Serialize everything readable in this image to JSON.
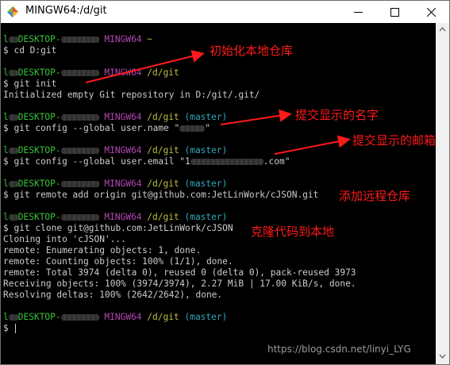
{
  "window": {
    "title": "MINGW64:/d/git"
  },
  "terminal": {
    "prompts": [
      {
        "user_host_fragment": "DESKTOP-",
        "shell": "MINGW64",
        "path": "~",
        "branch": ""
      },
      {
        "user_host_fragment": "DESKTOP-",
        "shell": "MINGW64",
        "path": "/d/git",
        "branch": ""
      },
      {
        "user_host_fragment": "DESKTOP-",
        "shell": "MINGW64",
        "path": "/d/git",
        "branch": "(master)"
      },
      {
        "user_host_fragment": "DESKTOP-",
        "shell": "MINGW64",
        "path": "/d/git",
        "branch": "(master)"
      },
      {
        "user_host_fragment": "DESKTOP-",
        "shell": "MINGW64",
        "path": "/d/git",
        "branch": "(master)"
      },
      {
        "user_host_fragment": "DESKTOP-",
        "shell": "MINGW64",
        "path": "/d/git",
        "branch": "(master)"
      },
      {
        "user_host_fragment": "DESKTOP-",
        "shell": "MINGW64",
        "path": "/d/git",
        "branch": "(master)"
      }
    ],
    "commands": {
      "cd": "$ cd D:git",
      "init": "$ git init",
      "config_name_prefix": "$ git config --global user.name \"",
      "config_name_suffix": "\"",
      "config_email_prefix": "$ git config --global user.email \"1",
      "config_email_suffix": ".com\"",
      "remote": "$ git remote add origin git@github.com:JetLinWork/cJSON.git",
      "clone": "$ git clone git@github.com:JetLinWork/cJSON",
      "empty_prompt": "$ "
    },
    "output": {
      "init": "Initialized empty Git repository in D:/git/.git/",
      "clone_lines": [
        "Cloning into 'cJSON'...",
        "remote: Enumerating objects: 1, done.",
        "remote: Counting objects: 100% (1/1), done.",
        "remote: Total 3974 (delta 0), reused 0 (delta 0), pack-reused 3973",
        "Receiving objects: 100% (3974/3974), 2.27 MiB | 17.00 KiB/s, done.",
        "Resolving deltas: 100% (2642/2642), done."
      ]
    }
  },
  "annotations": {
    "init_repo": "初始化本地仓库",
    "commit_name": "提交显示的名字",
    "commit_email": "提交显示的邮箱",
    "add_remote": "添加远程仓库",
    "clone_local": "克隆代码到本地",
    "color": "#ff1a1a"
  },
  "watermark": "https://blog.csdn.net/linyi_LYG",
  "colors": {
    "prompt_user": "#3cc23c",
    "prompt_shell": "#b347b3",
    "prompt_path": "#bfbf3f",
    "prompt_branch": "#30a8b8",
    "text": "#cccccc",
    "background": "#000000"
  }
}
